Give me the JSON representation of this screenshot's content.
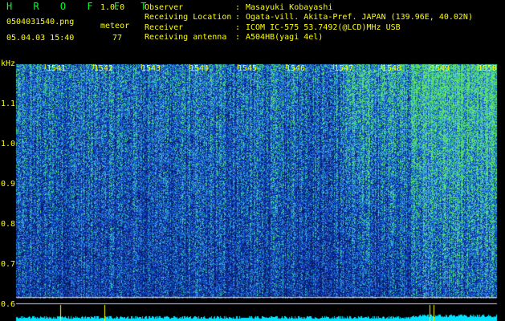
{
  "header": {
    "app_title": "H R O F F T",
    "app_version": "1.0.0",
    "filename": "0504031540.png",
    "meteor_label": "meteor",
    "datetime": "05.04.03 15:40",
    "meteor_count": "77"
  },
  "station_info": [
    {
      "key": "Observer",
      "value": "Masayuki Kobayashi"
    },
    {
      "key": "Receiving Location",
      "value": "Ogata-vill. Akita-Pref. JAPAN (139.96E, 40.02N)"
    },
    {
      "key": "Receiver",
      "value": "ICOM IC-575 53.7492(@LCD)MHz USB"
    },
    {
      "key": "Receiving antenna",
      "value": "A504HB(yagi 4el)"
    }
  ],
  "chart_data": {
    "type": "heatmap",
    "ylabel": "kHz",
    "y_ticks": [
      "1.1",
      "1.0",
      "0.9",
      "0.8",
      "0.7",
      "0.6"
    ],
    "ylim": [
      0.6,
      1.16
    ],
    "x_ticks": [
      "1541",
      "1542",
      "1543",
      "1544",
      "1545",
      "1546",
      "1547",
      "1548",
      "1549",
      "1550"
    ],
    "colormap": [
      "#0a1a60",
      "#0d2ca8",
      "#0f45d6",
      "#1f6cd8",
      "#2e9ad0",
      "#3ad0a8",
      "#66e85a"
    ],
    "level_colors": {
      "signal": "#00e0ff",
      "threshold_line": "#ffff00",
      "reference_line": "#d0d0e0"
    }
  }
}
